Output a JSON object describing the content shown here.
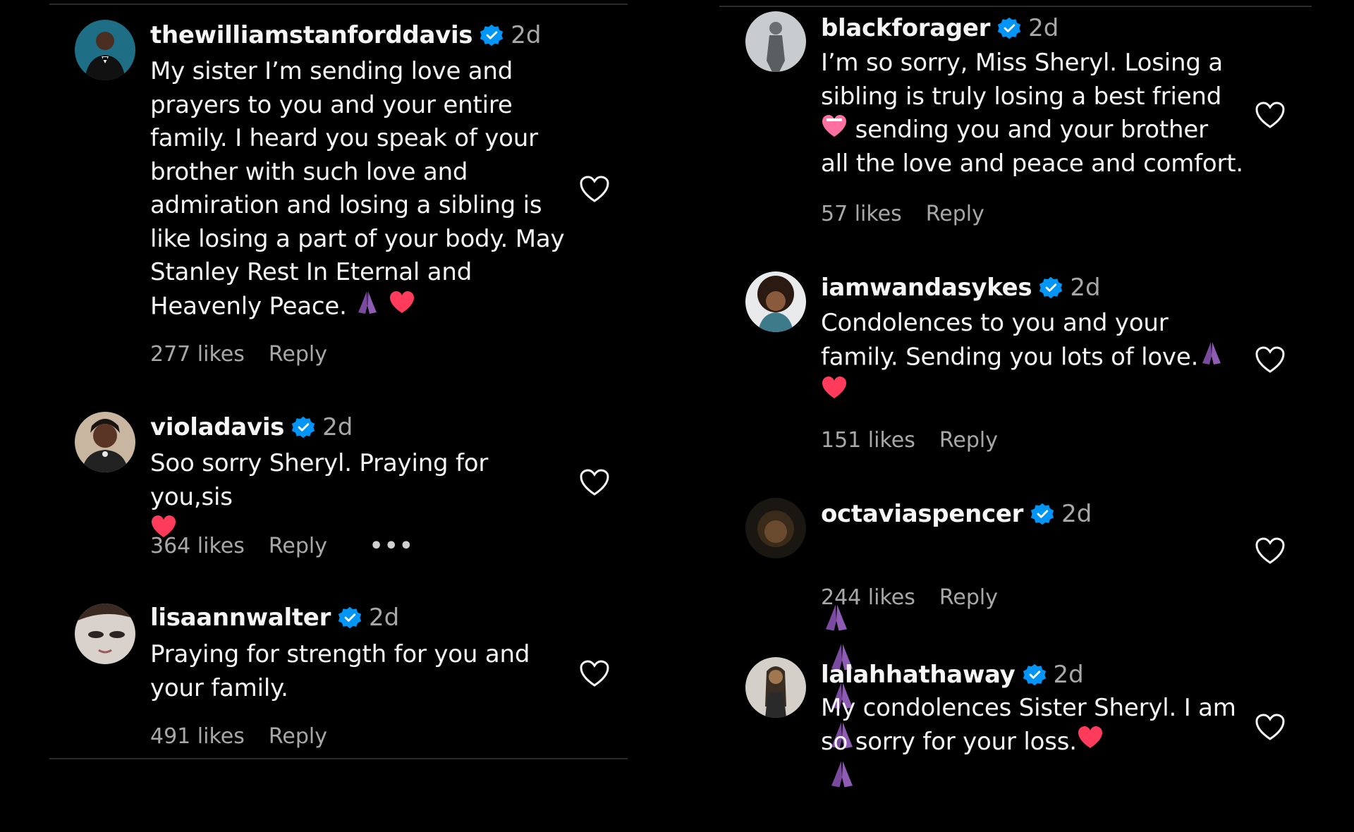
{
  "colors": {
    "background": "#000000",
    "text": "#f5f5f5",
    "muted": "#a8a8a8",
    "verified": "#0095f6",
    "heart_emoji": "#ff4d6d"
  },
  "icons": {
    "like": "heart-outline-icon",
    "verified": "verified-badge-icon",
    "pray": "folded-hands-emoji",
    "heart": "red-heart-emoji",
    "pink_heart": "pink-heart-emoji"
  },
  "left_column": [
    {
      "username": "thewilliamstanforddavis",
      "verified": true,
      "time": "2d",
      "text": "My sister I’m sending love and\nprayers to you and your entire\nfamily. I heard you speak of your\nbrother with such love and\nadmiration and losing a sibling is\nlike losing a part of your body. May\nStanley Rest In Eternal and\nHeavenly Peace. ",
      "likes": "277 likes",
      "reply": "Reply"
    },
    {
      "username": "violadavis",
      "verified": true,
      "time": "2d",
      "text": "Soo sorry Sheryl. Praying for you,sis\n",
      "likes": "364 likes",
      "reply": "Reply",
      "more": "•••"
    },
    {
      "username": "lisaannwalter",
      "verified": true,
      "time": "2d",
      "text": "Praying for strength for you and\nyour family.",
      "likes": "491 likes",
      "reply": "Reply"
    }
  ],
  "right_column": [
    {
      "username": "blackforager",
      "verified": true,
      "time": "2d",
      "text_line1": "I’m so sorry, Miss Sheryl. Losing a\nsibling is truly losing a best friend\n",
      "text_line2": " sending you and your brother\nall the love and peace and comfort.",
      "likes": "57 likes",
      "reply": "Reply"
    },
    {
      "username": "iamwandasykes",
      "verified": true,
      "time": "2d",
      "text": "Condolences to you and your\nfamily. Sending you lots of love.",
      "likes": "151 likes",
      "reply": "Reply"
    },
    {
      "username": "octaviaspencer",
      "verified": true,
      "time": "2d",
      "likes": "244 likes",
      "reply": "Reply"
    },
    {
      "username": "lalahhathaway",
      "verified": true,
      "time": "2d",
      "text": "My condolences Sister Sheryl. I am\nso sorry for your loss.",
      "likes": "",
      "reply": ""
    }
  ]
}
